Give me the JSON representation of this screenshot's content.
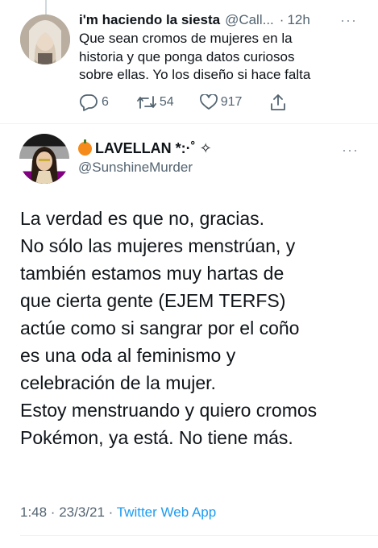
{
  "reply_tweet": {
    "display_name": "i'm haciendo la siesta",
    "handle": "@Call...",
    "time_separator": "·",
    "time": "12h",
    "more_glyph": "···",
    "text_lines": [
      "Que sean cromos de mujeres en la",
      "historia y que ponga datos curiosos",
      "sobre ellas. Yo los diseño si hace falta"
    ],
    "actions": {
      "reply_count": "6",
      "retweet_count": "54",
      "like_count": "917"
    }
  },
  "main_tweet": {
    "display_name": "LAVELLAN *:·˚ ✧",
    "handle": "@SunshineMurder",
    "more_glyph": "···",
    "text_lines": [
      "La verdad es que no, gracias.",
      "No sólo las mujeres menstrúan, y",
      "también estamos muy hartas de",
      "que cierta gente (EJEM TERFS)",
      "actúe como si sangrar por el coño",
      "es una oda al feminismo y",
      "celebración de la mujer.",
      "Estoy menstruando y quiero cromos",
      "Pokémon, ya está. No tiene más."
    ],
    "timestamp": "1:48 · 23/3/21 ·",
    "source": "Twitter Web App"
  },
  "colors": {
    "text": "#0f1419",
    "secondary": "#536471",
    "link": "#1d9bf0",
    "divider": "#eff3f4"
  },
  "icons": {
    "reply": "speech-bubble-icon",
    "retweet": "retweet-icon",
    "like": "heart-icon",
    "share": "share-icon",
    "pumpkin": "pumpkin-emoji-icon"
  }
}
